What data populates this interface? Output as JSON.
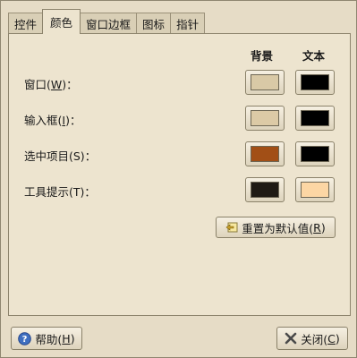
{
  "tabs": [
    {
      "label": "控件",
      "active": false
    },
    {
      "label": "颜色",
      "active": true
    },
    {
      "label": "窗口边框",
      "active": false
    },
    {
      "label": "图标",
      "active": false
    },
    {
      "label": "指针",
      "active": false
    }
  ],
  "headers": {
    "background": "背景",
    "text": "文本"
  },
  "rows": [
    {
      "label_pre": "窗口(",
      "mnemonic": "W",
      "label_post": ")：",
      "bg_color": "#d9c9a6",
      "fg_color": "#000000"
    },
    {
      "label_pre": "输入框(",
      "mnemonic": "I",
      "label_post": ")：",
      "bg_color": "#dccaa6",
      "fg_color": "#000000"
    },
    {
      "label_pre": "选中项目(S)：",
      "mnemonic": "",
      "label_post": "",
      "bg_color": "#a24f16",
      "fg_color": "#000000"
    },
    {
      "label_pre": "工具提示(T)：",
      "mnemonic": "",
      "label_post": "",
      "bg_color": "#1f1a14",
      "fg_color": "#fcd6a4"
    }
  ],
  "reset_button": {
    "label_pre": "重置为默认值(",
    "mnemonic": "R",
    "label_post": ")"
  },
  "help_button": {
    "label_pre": "帮助(",
    "mnemonic": "H",
    "label_post": ")"
  },
  "close_button": {
    "label_pre": "关闭(",
    "mnemonic": "C",
    "label_post": ")"
  }
}
